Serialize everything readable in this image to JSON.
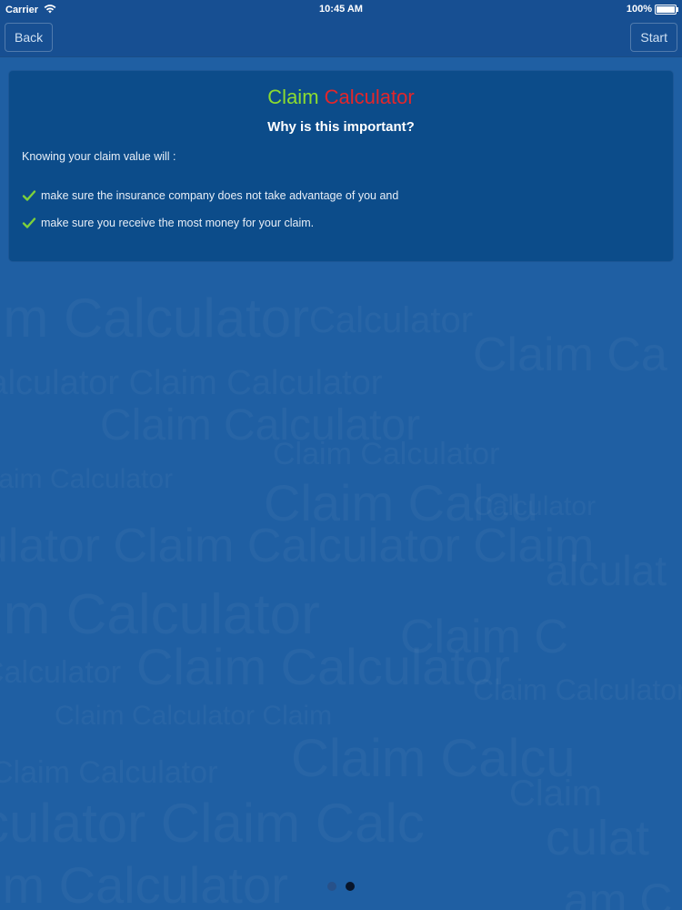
{
  "status_bar": {
    "carrier": "Carrier",
    "time": "10:45 AM",
    "battery": "100%"
  },
  "nav": {
    "back_label": "Back",
    "start_label": "Start"
  },
  "card": {
    "title_part1": "Claim",
    "title_part2": "Calculator",
    "subtitle": "Why is this important?",
    "intro": "Knowing your claim value will :",
    "bullets": [
      "make sure the insurance company does not take advantage of you and",
      "make sure you receive the most money for your claim."
    ]
  },
  "pagination": {
    "pages": 2,
    "current": 2
  },
  "colors": {
    "background": "#1f5fa3",
    "bar": "#174f92",
    "card": "#0c4c8a",
    "title_green": "#8ddc2f",
    "title_red": "#e3262a",
    "check_green": "#7ed13a"
  },
  "icons": {
    "wifi": "wifi-icon",
    "battery": "battery-icon",
    "check": "check-icon"
  }
}
